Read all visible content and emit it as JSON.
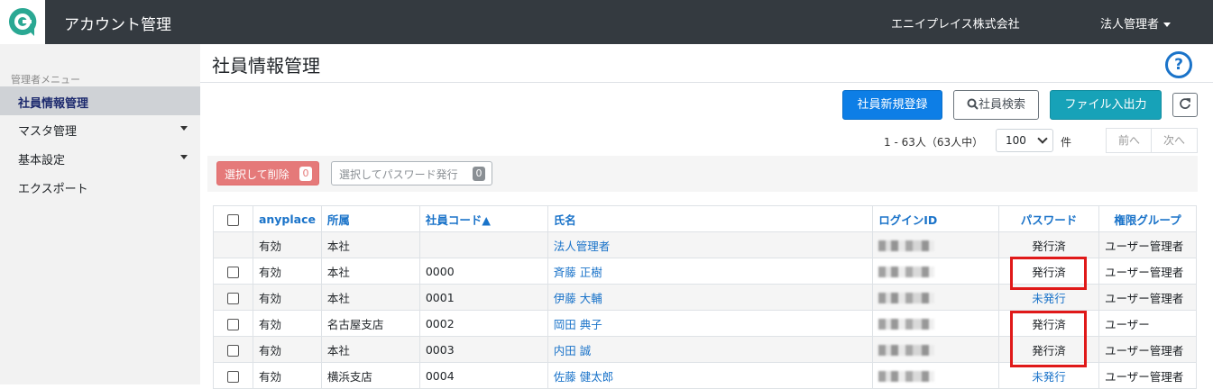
{
  "header": {
    "app_title": "アカウント管理",
    "company": "エニイプレイス株式会社",
    "user_menu": "法人管理者"
  },
  "sidebar": {
    "heading": "管理者メニュー",
    "items": [
      {
        "label": "社員情報管理",
        "active": true
      },
      {
        "label": "マスタ管理",
        "has_submenu": true
      },
      {
        "label": "基本設定",
        "has_submenu": true
      },
      {
        "label": "エクスポート"
      }
    ]
  },
  "page": {
    "title": "社員情報管理",
    "help_icon": "?",
    "buttons": {
      "new_register": "社員新規登録",
      "search": "社員検索",
      "file_io": "ファイル入出力"
    },
    "pager": {
      "info": "1 - 63人（63人中）",
      "per_page": "100",
      "per_page_unit": "件",
      "prev": "前へ",
      "next": "次へ"
    },
    "actions": {
      "delete_label": "選択して削除",
      "delete_count": "0",
      "password_label": "選択してパスワード発行",
      "password_count": "0"
    }
  },
  "table": {
    "columns": [
      "anyplace",
      "所属",
      "社員コード▲",
      "氏名",
      "ログインID",
      "パスワード",
      "権限グループ"
    ],
    "rows": [
      {
        "checkbox": false,
        "anyplace": "有効",
        "dept": "本社",
        "code": "",
        "name": "法人管理者",
        "password": "発行済",
        "group": "ユーザー管理者"
      },
      {
        "checkbox": true,
        "anyplace": "有効",
        "dept": "本社",
        "code": "0000",
        "name": "斉藤 正樹",
        "password": "発行済",
        "group": "ユーザー管理者"
      },
      {
        "checkbox": true,
        "anyplace": "有効",
        "dept": "本社",
        "code": "0001",
        "name": "伊藤 大輔",
        "password": "未発行",
        "group": "ユーザー管理者"
      },
      {
        "checkbox": true,
        "anyplace": "有効",
        "dept": "名古屋支店",
        "code": "0002",
        "name": "岡田 典子",
        "password": "発行済",
        "group": "ユーザー"
      },
      {
        "checkbox": true,
        "anyplace": "有効",
        "dept": "本社",
        "code": "0003",
        "name": "内田 誠",
        "password": "発行済",
        "group": "ユーザー管理者"
      },
      {
        "checkbox": true,
        "anyplace": "有効",
        "dept": "横浜支店",
        "code": "0004",
        "name": "佐藤 健太郎",
        "password": "未発行",
        "group": "ユーザー管理者"
      }
    ]
  },
  "colors": {
    "topbar": "#343a40",
    "primary": "#0d7ee6",
    "teal": "#17a2b8",
    "link": "#1a73c9",
    "delete": "#e57373",
    "highlight": "#e01919"
  }
}
